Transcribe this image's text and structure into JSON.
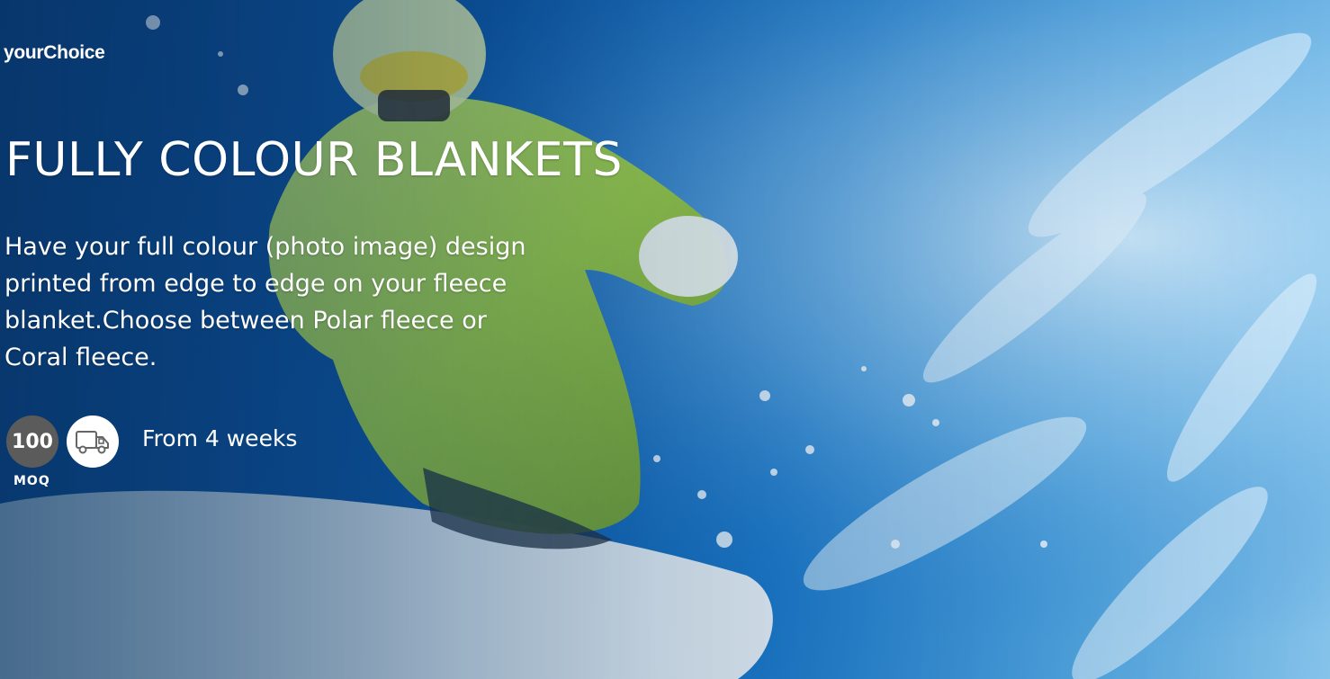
{
  "brand": {
    "logo_text": "yourChoice"
  },
  "hero": {
    "title": "FULLY COLOUR BLANKETS",
    "description": "Have your full colour (photo image) design printed from edge to edge on your fleece blanket.Choose between Polar fleece or Coral fleece.",
    "background_image": "snowboarder-photo"
  },
  "badges": {
    "moq_value": "100",
    "moq_label": "MOQ",
    "delivery_icon": "delivery-truck-icon",
    "lead_time": "From 4 weeks"
  },
  "colors": {
    "text": "#ffffff",
    "moq_badge_bg": "#5b5b5b",
    "truck_badge_bg": "#ffffff",
    "sky_dark": "#0b3f7c",
    "sky_light": "#86c3ea",
    "jacket_green": "#b8e04a"
  }
}
